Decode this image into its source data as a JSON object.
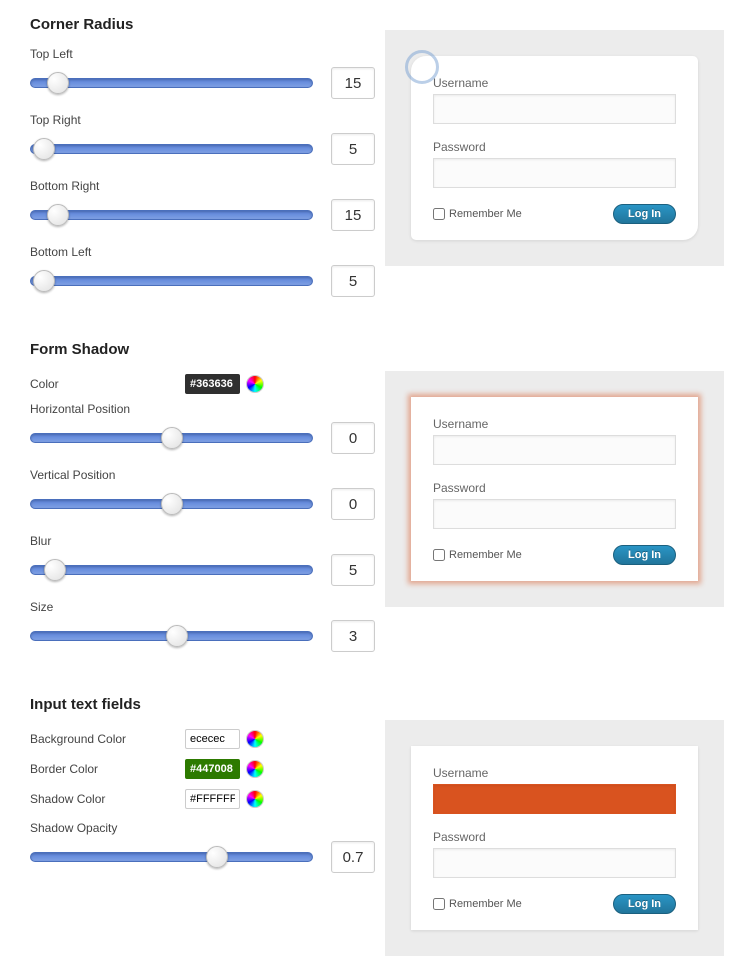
{
  "sections": {
    "corner_radius": {
      "title": "Corner Radius",
      "sliders": {
        "top_left": {
          "label": "Top Left",
          "value": "15",
          "pos": 10
        },
        "top_right": {
          "label": "Top Right",
          "value": "5",
          "pos": 5
        },
        "bottom_right": {
          "label": "Bottom Right",
          "value": "15",
          "pos": 10
        },
        "bottom_left": {
          "label": "Bottom Left",
          "value": "5",
          "pos": 5
        }
      }
    },
    "form_shadow": {
      "title": "Form Shadow",
      "color_label": "Color",
      "color_value": "#363636",
      "sliders": {
        "hpos": {
          "label": "Horizontal Position",
          "value": "0",
          "pos": 50
        },
        "vpos": {
          "label": "Vertical Position",
          "value": "0",
          "pos": 50
        },
        "blur": {
          "label": "Blur",
          "value": "5",
          "pos": 9
        },
        "size": {
          "label": "Size",
          "value": "3",
          "pos": 52
        }
      }
    },
    "input_fields": {
      "title": "Input text fields",
      "bg_label": "Background Color",
      "bg_value": "ececec",
      "border_label": "Border Color",
      "border_value": "#447008",
      "shadow_label": "Shadow Color",
      "shadow_value": "#FFFFFF",
      "opacity": {
        "label": "Shadow Opacity",
        "value": "0.7",
        "pos": 66
      }
    }
  },
  "preview": {
    "username_label": "Username",
    "password_label": "Password",
    "remember_label": "Remember Me",
    "login_label": "Log In"
  }
}
